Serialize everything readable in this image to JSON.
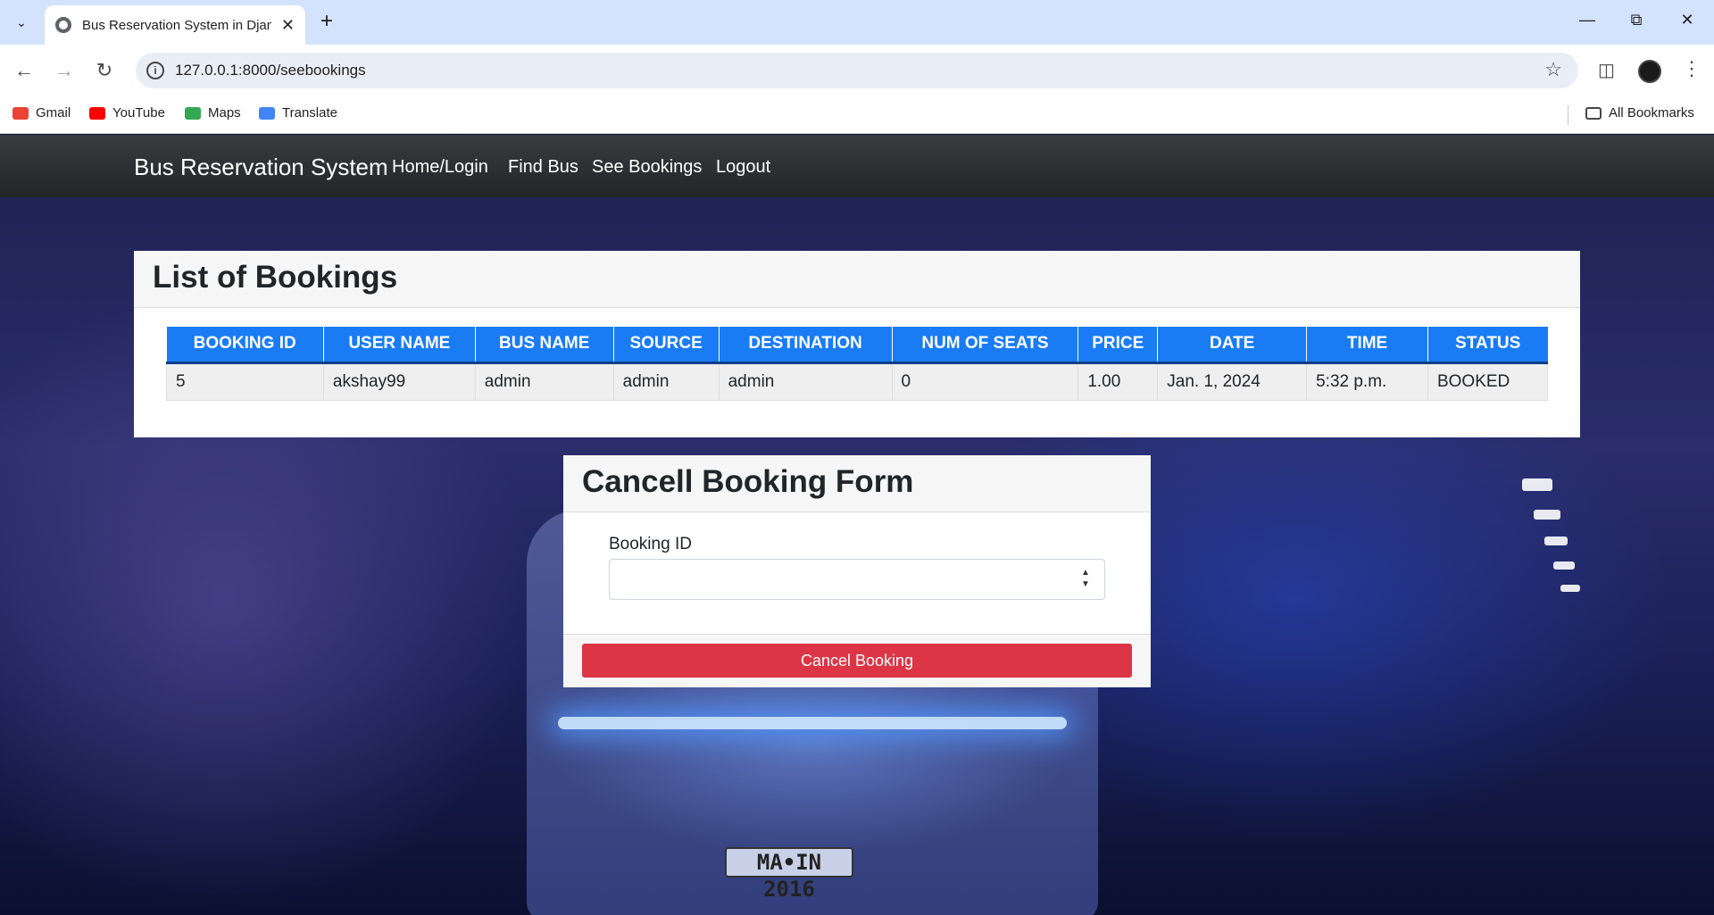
{
  "browser": {
    "tab_title": "Bus Reservation System in Djan",
    "url": "127.0.0.1:8000/seebookings",
    "bookmarks": [
      "Gmail",
      "YouTube",
      "Maps",
      "Translate"
    ],
    "all_bookmarks": "All Bookmarks"
  },
  "navbar": {
    "brand": "Bus Reservation System",
    "links": [
      "Home/Login",
      "Find Bus",
      "See Bookings",
      "Logout"
    ]
  },
  "bookings": {
    "title": "List of Bookings",
    "columns": [
      "BOOKING ID",
      "USER NAME",
      "BUS NAME",
      "SOURCE",
      "DESTINATION",
      "NUM OF SEATS",
      "PRICE",
      "DATE",
      "TIME",
      "STATUS"
    ],
    "rows": [
      [
        "5",
        "akshay99",
        "admin",
        "admin",
        "admin",
        "0",
        "1.00",
        "Jan. 1, 2024",
        "5:32 p.m.",
        "BOOKED"
      ]
    ]
  },
  "cancel_form": {
    "title": "Cancell Booking Form",
    "field_label": "Booking ID",
    "field_value": "",
    "button_label": "Cancel Booking"
  },
  "background": {
    "plate_text": "MA•IN 2016"
  },
  "colors": {
    "table_header": "#1a7cf5",
    "danger_button": "#dc3545",
    "navbar": "#2b2d30"
  }
}
